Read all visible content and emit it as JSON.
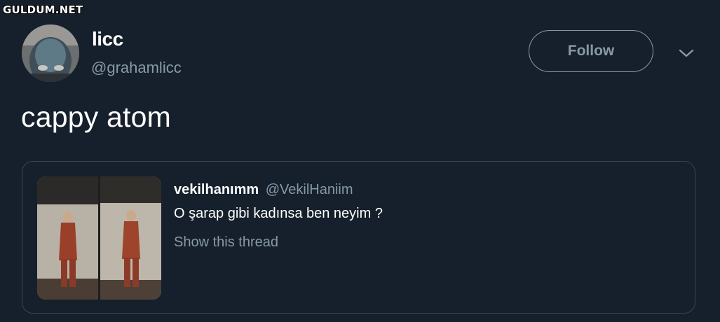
{
  "watermark": "GULDUM.NET",
  "author": {
    "display_name": "licc",
    "handle": "@grahamlicc",
    "avatar": "avatar-photo"
  },
  "follow_button": {
    "label": "Follow"
  },
  "menu": {
    "icon": "chevron-down-icon"
  },
  "tweet": {
    "text": "cappy atom"
  },
  "quoted_tweet": {
    "display_name": "vekilhanımm",
    "handle": "@VekilHaniim",
    "text": "O şarap gibi kadınsa ben neyim ?",
    "show_thread_label": "Show this thread",
    "media": "two-side-by-side-photos"
  },
  "colors": {
    "background": "#16202c",
    "secondary_text": "#8899a6",
    "border": "#38444d",
    "primary_text": "#ffffff"
  }
}
